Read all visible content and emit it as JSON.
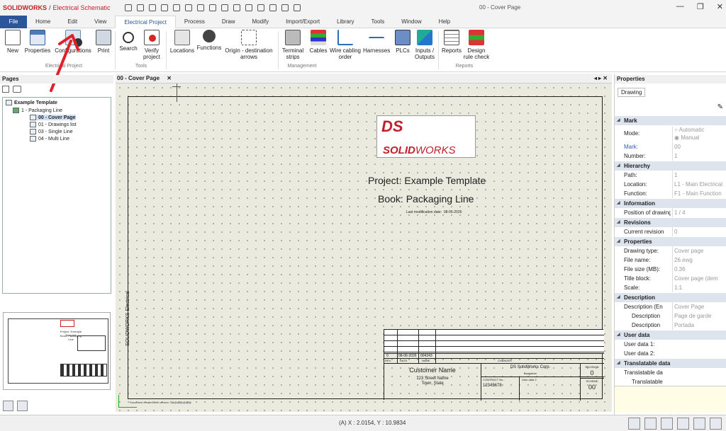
{
  "app": {
    "brand": "SOLIDWORKS",
    "separator": "/",
    "product": "Electrical Schematic",
    "window_title": "00 - Cover Page",
    "win_min": "—",
    "win_max": "❐",
    "win_close": "✕"
  },
  "tabs": [
    "File",
    "Home",
    "Edit",
    "View",
    "Electrical Project",
    "Process",
    "Draw",
    "Modify",
    "Import/Export",
    "Library",
    "Tools",
    "Window",
    "Help"
  ],
  "ribbon": {
    "new": "New",
    "properties": "Properties",
    "configurations": "Configurations",
    "print": "Print",
    "search": "Search",
    "verify_project": "Verify project",
    "locations": "Locations",
    "functions": "Functions",
    "origin_destination": "Origin - destination arrows",
    "terminal_strips": "Terminal strips",
    "cables": "Cables",
    "wire_cabling_order": "Wire cabling order",
    "harnesses": "Harnesses",
    "plcs": "PLCs",
    "inputs_outputs": "Inputs / Outputs",
    "reports": "Reports",
    "design_rule_check": "Design rule check",
    "group_project": "Electrical Project",
    "group_tools": "Tools",
    "group_management": "Management",
    "group_reports": "Reports"
  },
  "pages_panel": {
    "title": "Pages",
    "tree": {
      "root": "Example Template",
      "book": "1 - Packaging Line",
      "pages": [
        "00 - Cover Page",
        "01 - Drawings list",
        "03 - Single Line",
        "04 - Multi Line"
      ]
    }
  },
  "document": {
    "tab_label": "00 - Cover Page",
    "brand_top": "DS",
    "brand_solid": "SOLID",
    "brand_works": "WORKS",
    "project_line": "Project: Example Template",
    "book_line": "Book: Packaging Line",
    "last_mod_label": "Last modification date:",
    "last_mod_value": "08-06-2026",
    "side_text": "SOLIDWORKS Electrical",
    "bottom_note": "Document created with version - @@@@@@@",
    "revision_row": {
      "rev": "0",
      "date": "08-06-2026",
      "name": "004243"
    },
    "rev_headers": {
      "rev": "REV.",
      "date": "DATE",
      "name": "NAME",
      "changes": "CHANGES"
    },
    "customer": {
      "name": "Customer Name",
      "street": "123 Street Name",
      "city": "Town, State"
    },
    "company": {
      "name": "DS SolidWorks Corp.",
      "city": "Bangalore",
      "contract_label": "CONTRACT No :",
      "contract_value": "12345678",
      "user_data_label": "User data 2"
    },
    "revision_label": "REVISION",
    "revision_value": "0",
    "scheme_label": "SCHEME",
    "scheme_value": "00"
  },
  "properties_panel": {
    "title": "Properties",
    "drawing_tab": "Drawing",
    "sections": {
      "mark": "Mark",
      "hierarchy": "Hierarchy",
      "information": "Information",
      "revisions": "Revisions",
      "properties": "Properties",
      "description": "Description",
      "user_data": "User data",
      "translatable": "Translatable data"
    },
    "rows": {
      "mode_label": "Mode:",
      "mode_auto": "Automatic",
      "mode_manual": "Manual",
      "mark_label": "Mark:",
      "mark_value": "00",
      "number_label": "Number:",
      "number_value": "1",
      "path_label": "Path:",
      "path_value": "1",
      "location_label": "Location:",
      "location_value": "L1 - Main Electrical",
      "function_label": "Function:",
      "function_value": "F1 - Main Function",
      "position_label": "Position of drawing",
      "position_value": "1 / 4",
      "current_rev_label": "Current revision",
      "current_rev_value": "0",
      "drawing_type_label": "Drawing type:",
      "drawing_type_value": "Cover page",
      "file_name_label": "File name:",
      "file_name_value": "26.ewg",
      "file_size_label": "File size (MB):",
      "file_size_value": "0.36",
      "title_block_label": "Title block:",
      "title_block_value": "Cover page (dem",
      "scale_label": "Scale:",
      "scale_value": "1:1",
      "desc_en_label": "Description (En",
      "desc_en_value": "Cover Page",
      "desc_fr_label": "Description",
      "desc_fr_value": "Page de garde",
      "desc_es_label": "Description",
      "desc_es_value": "Portada",
      "user1_label": "User data 1:",
      "user2_label": "User data 2:",
      "trans1_label": "Translatable da",
      "trans2_label": "Translatable"
    }
  },
  "status": {
    "coords": "(A) X : 2.0154, Y : 10.9834"
  },
  "colors": {
    "file_tab": "#2b579a",
    "brand_red": "#c0202a",
    "canvas": "#eaeadf",
    "annotation_arrow": "#e0202a"
  }
}
